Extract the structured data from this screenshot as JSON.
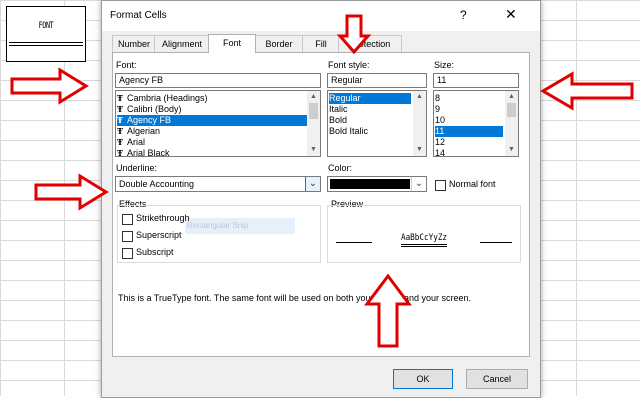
{
  "cell": {
    "text": "FONT"
  },
  "dialog": {
    "title": "Format Cells",
    "help": "?",
    "close": "✕",
    "tabs": [
      "Number",
      "Alignment",
      "Font",
      "Border",
      "Fill",
      "Protection"
    ],
    "active_tab": "Font"
  },
  "font": {
    "label": "Font:",
    "value": "Agency FB",
    "items": [
      "Cambria (Headings)",
      "Calibri (Body)",
      "Agency FB",
      "Algerian",
      "Arial",
      "Arial Black"
    ],
    "selected": "Agency FB"
  },
  "style": {
    "label": "Font style:",
    "value": "Regular",
    "items": [
      "Regular",
      "Italic",
      "Bold",
      "Bold Italic"
    ],
    "selected": "Regular"
  },
  "size": {
    "label": "Size:",
    "value": "11",
    "items": [
      "8",
      "9",
      "10",
      "11",
      "12",
      "14"
    ],
    "selected": "11"
  },
  "underline": {
    "label": "Underline:",
    "value": "Double Accounting"
  },
  "color": {
    "label": "Color:",
    "swatch": "#000000",
    "normal_font": "Normal font"
  },
  "effects": {
    "label": "Effects",
    "items": [
      "Strikethrough",
      "Superscript",
      "Subscript"
    ],
    "ghost": "Rectangular Snip"
  },
  "preview": {
    "label": "Preview",
    "sample": "AaBbCcYyZz"
  },
  "info": "This is a TrueType font.  The same font will be used on both your printer and your screen.",
  "buttons": {
    "ok": "OK",
    "cancel": "Cancel"
  },
  "colors": {
    "accent": "#0078d7",
    "arrow": "#e00000"
  }
}
